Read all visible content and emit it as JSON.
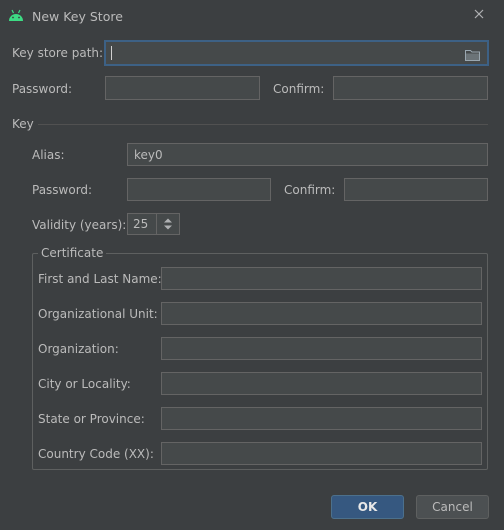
{
  "window": {
    "title": "New Key Store",
    "app_icon": "android-icon",
    "close_icon": "close-icon"
  },
  "keystore": {
    "path_label": "Key store path:",
    "path_value": "",
    "browse_icon": "folder-icon",
    "password_label": "Password:",
    "confirm_label": "Confirm:"
  },
  "key": {
    "section_label": "Key",
    "alias_label": "Alias:",
    "alias_value": "key0",
    "password_label": "Password:",
    "confirm_label": "Confirm:",
    "validity_label": "Validity (years):",
    "validity_value": "25"
  },
  "certificate": {
    "group_label": "Certificate",
    "fields": [
      {
        "label": "First and Last Name:",
        "value": ""
      },
      {
        "label": "Organizational Unit:",
        "value": ""
      },
      {
        "label": "Organization:",
        "value": ""
      },
      {
        "label": "City or Locality:",
        "value": ""
      },
      {
        "label": "State or Province:",
        "value": ""
      },
      {
        "label": "Country Code (XX):",
        "value": ""
      }
    ]
  },
  "buttons": {
    "ok_label": "OK",
    "cancel_label": "Cancel"
  },
  "colors": {
    "background": "#3c3f41",
    "field_background": "#45494a",
    "focus_border": "#3d6185",
    "primary_button": "#365880",
    "android_green": "#3ddc84"
  }
}
